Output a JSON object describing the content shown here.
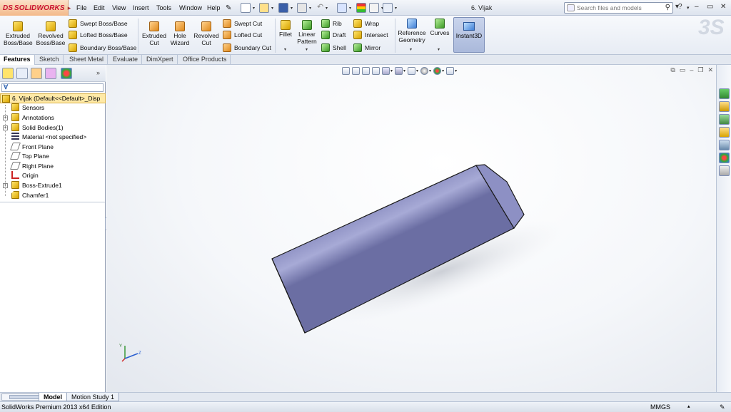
{
  "app": {
    "logo_ds": "DS",
    "logo_name": "SOLIDWORKS",
    "document_title": "6. Vijak",
    "menus": [
      "File",
      "Edit",
      "View",
      "Insert",
      "Tools",
      "Window",
      "Help"
    ],
    "search_placeholder": "Search files and models"
  },
  "ribbon": {
    "extruded_boss": [
      "Extruded",
      "Boss/Base"
    ],
    "revolved_boss": [
      "Revolved",
      "Boss/Base"
    ],
    "swept_boss": "Swept Boss/Base",
    "lofted_boss": "Lofted Boss/Base",
    "boundary_boss": "Boundary Boss/Base",
    "extruded_cut": [
      "Extruded",
      "Cut"
    ],
    "hole_wizard": [
      "Hole",
      "Wizard"
    ],
    "revolved_cut": [
      "Revolved",
      "Cut"
    ],
    "swept_cut": "Swept Cut",
    "lofted_cut": "Lofted Cut",
    "boundary_cut": "Boundary Cut",
    "fillet": "Fillet",
    "linear_pattern": [
      "Linear",
      "Pattern"
    ],
    "rib": "Rib",
    "draft": "Draft",
    "shell": "Shell",
    "wrap": "Wrap",
    "intersect": "Intersect",
    "mirror": "Mirror",
    "reference_geometry": [
      "Reference",
      "Geometry"
    ],
    "curves": "Curves",
    "instant3d": "Instant3D"
  },
  "tabs": [
    "Features",
    "Sketch",
    "Sheet Metal",
    "Evaluate",
    "DimXpert",
    "Office Products"
  ],
  "tree": {
    "root": "6. Vijak  (Default<<Default>_Disp",
    "items": [
      {
        "label": "Sensors",
        "icon": "sensors-icon",
        "expandable": false
      },
      {
        "label": "Annotations",
        "icon": "annotations-icon",
        "expandable": true
      },
      {
        "label": "Solid Bodies(1)",
        "icon": "solid-bodies-icon",
        "expandable": true
      },
      {
        "label": "Material <not specified>",
        "icon": "material-icon",
        "expandable": false
      },
      {
        "label": "Front Plane",
        "icon": "plane-icon",
        "expandable": false
      },
      {
        "label": "Top Plane",
        "icon": "plane-icon",
        "expandable": false
      },
      {
        "label": "Right Plane",
        "icon": "plane-icon",
        "expandable": false
      },
      {
        "label": "Origin",
        "icon": "origin-icon",
        "expandable": false
      },
      {
        "label": "Boss-Extrude1",
        "icon": "extrude-icon",
        "expandable": true
      },
      {
        "label": "Chamfer1",
        "icon": "chamfer-icon",
        "expandable": false
      }
    ]
  },
  "triad": {
    "y": "Y",
    "z": "Z"
  },
  "bottom_tabs": [
    "Model",
    "Motion Study 1"
  ],
  "status": {
    "text": "SolidWorks Premium 2013 x64 Edition",
    "units": "MMGS"
  },
  "colors": {
    "part_body": "#9aa0d0",
    "tree_selected": "#ffe9a6",
    "accent": "#c8102e"
  }
}
